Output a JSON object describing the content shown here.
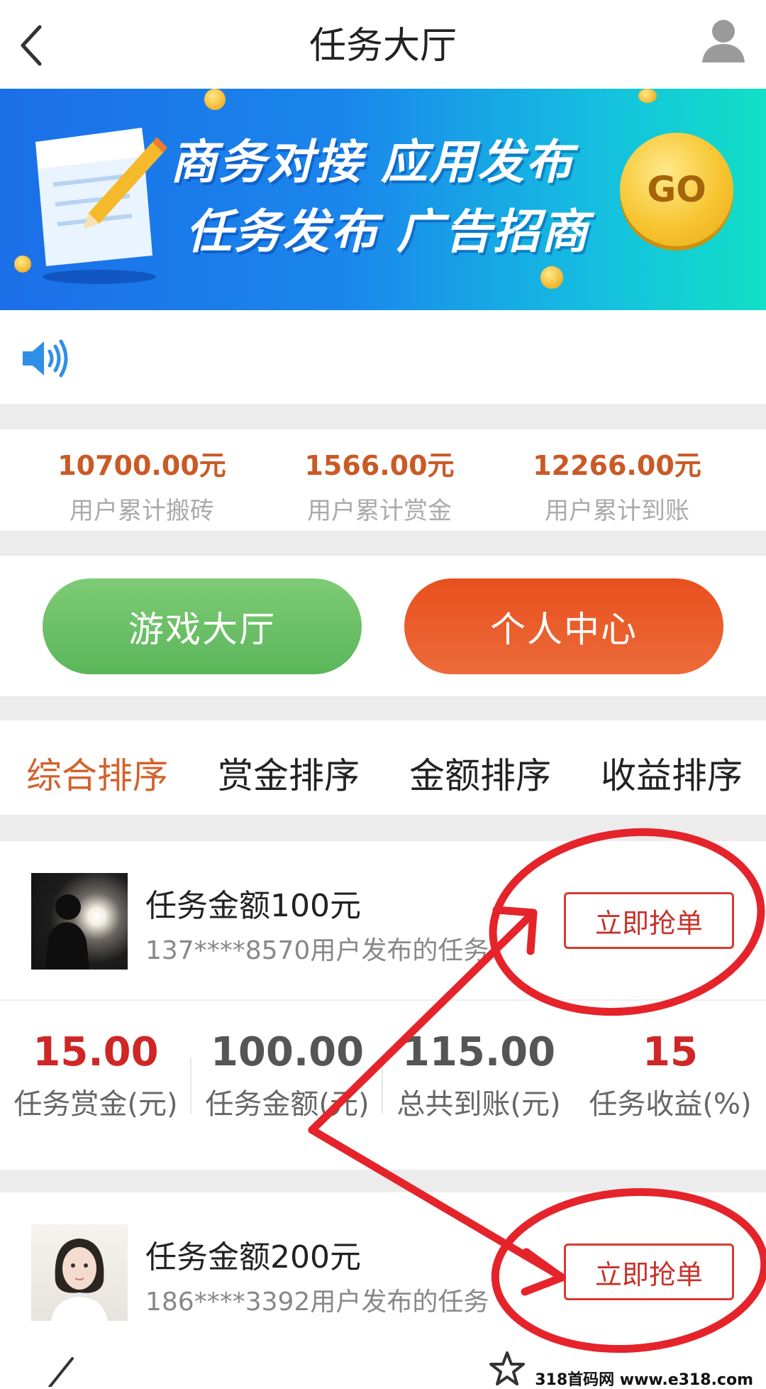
{
  "header": {
    "title": "任务大厅"
  },
  "banner": {
    "line1": "商务对接 应用发布",
    "line2": "任务发布 广告招商",
    "go_label": "GO"
  },
  "stats": [
    {
      "value": "10700.00元",
      "label": "用户累计搬砖"
    },
    {
      "value": "1566.00元",
      "label": "用户累计赏金"
    },
    {
      "value": "12266.00元",
      "label": "用户累计到账"
    }
  ],
  "actions": {
    "game_hall": "游戏大厅",
    "personal_center": "个人中心"
  },
  "sort_tabs": [
    {
      "label": "综合排序",
      "active": true
    },
    {
      "label": "赏金排序",
      "active": false
    },
    {
      "label": "金额排序",
      "active": false
    },
    {
      "label": "收益排序",
      "active": false
    }
  ],
  "tasks": [
    {
      "title": "任务金额100元",
      "desc": "137****8570用户发布的任务",
      "button": "立即抢单",
      "metrics": [
        {
          "value": "15.00",
          "label": "任务赏金(元)"
        },
        {
          "value": "100.00",
          "label": "任务金额(元)"
        },
        {
          "value": "115.00",
          "label": "总共到账(元)"
        },
        {
          "value": "15",
          "label": "任务收益(%)"
        }
      ]
    },
    {
      "title": "任务金额200元",
      "desc": "186****3392用户发布的任务",
      "button": "立即抢单"
    }
  ],
  "watermark": "318首码网 www.e318.com",
  "colors": {
    "accent_orange": "#d1632e",
    "value_red": "#cf2626",
    "game_green": "#5bb65a",
    "personal_orange": "#e8501e",
    "annotation_red": "#e5232a"
  }
}
